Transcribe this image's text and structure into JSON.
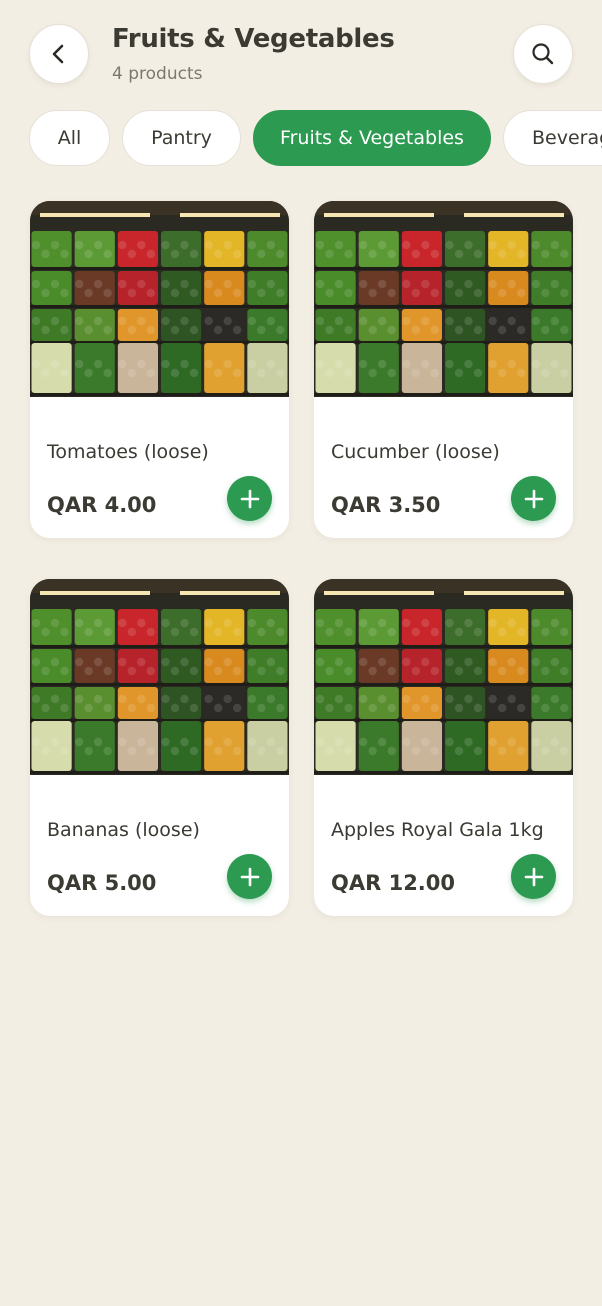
{
  "header": {
    "title": "Fruits & Vegetables",
    "subtitle": "4 products",
    "back_icon": "chevron-left-icon",
    "search_icon": "search-icon"
  },
  "categories": [
    {
      "label": "All",
      "active": false
    },
    {
      "label": "Pantry",
      "active": false
    },
    {
      "label": "Fruits & Vegetables",
      "active": true
    },
    {
      "label": "Beverages",
      "active": false
    }
  ],
  "currency": "QAR",
  "products": [
    {
      "name": "Tomatoes (loose)",
      "price": "QAR 4.00"
    },
    {
      "name": "Cucumber (loose)",
      "price": "QAR 3.50"
    },
    {
      "name": "Bananas (loose)",
      "price": "QAR 5.00"
    },
    {
      "name": "Apples Royal Gala 1kg",
      "price": "QAR 12.00"
    }
  ],
  "colors": {
    "background": "#f3eee3",
    "accent": "#2d9a52",
    "text": "#3b3a33",
    "muted": "#7b786f"
  }
}
